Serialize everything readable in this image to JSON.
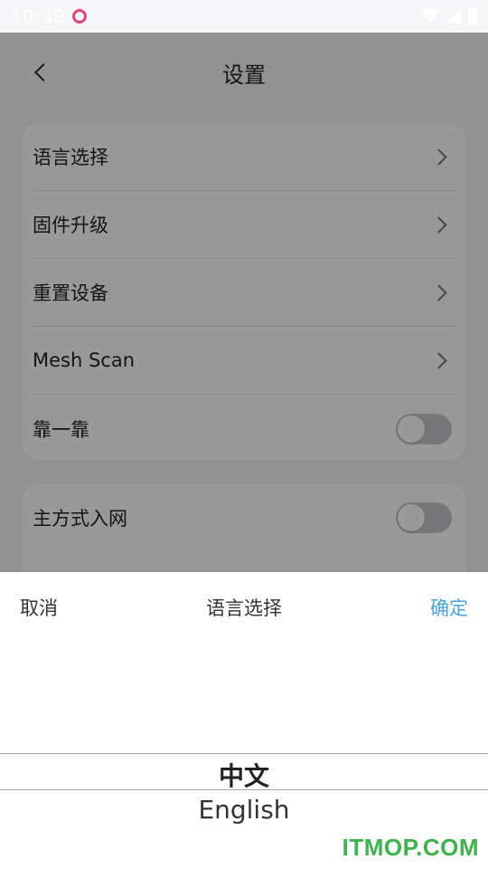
{
  "status_bar": {
    "time": "10:39"
  },
  "header": {
    "title": "设置"
  },
  "settings_card1": [
    {
      "label": "语言选择",
      "type": "chevron"
    },
    {
      "label": "固件升级",
      "type": "chevron"
    },
    {
      "label": "重置设备",
      "type": "chevron"
    },
    {
      "label": "Mesh Scan",
      "type": "chevron"
    },
    {
      "label": "靠一靠",
      "type": "toggle"
    }
  ],
  "settings_card2": [
    {
      "label": "主方式入网",
      "type": "toggle"
    }
  ],
  "sheet": {
    "cancel": "取消",
    "title": "语言选择",
    "confirm": "确定",
    "options": [
      "中文",
      "English"
    ],
    "selected_index": 0
  },
  "watermark": "ITMOP.COM",
  "colors": {
    "accent": "#46a6e3",
    "watermark": "#3cb44b"
  }
}
